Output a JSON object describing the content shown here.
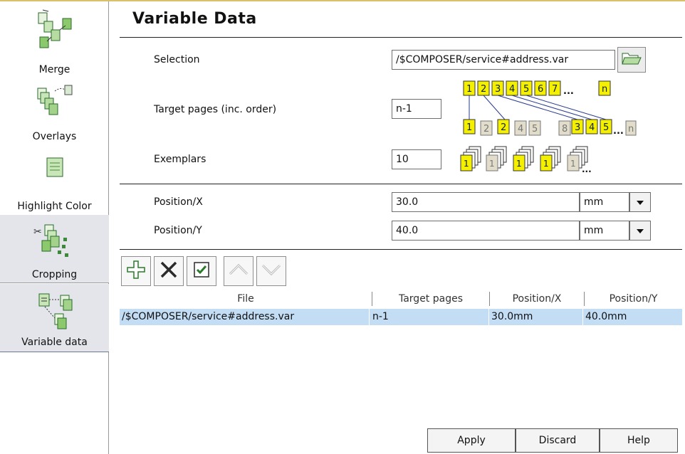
{
  "sidebar": {
    "items": [
      {
        "label": "Merge",
        "icon": "merge-icon"
      },
      {
        "label": "Overlays",
        "icon": "overlays-icon"
      },
      {
        "label": "Highlight Color",
        "icon": "highlight-color-icon"
      },
      {
        "label": "Cropping",
        "icon": "cropping-icon"
      },
      {
        "label": "Variable data",
        "icon": "variable-data-icon"
      }
    ]
  },
  "main": {
    "title": "Variable Data",
    "selection": {
      "label": "Selection",
      "value": "/$COMPOSER/service#address.var",
      "browse_icon": "folder-open-icon"
    },
    "target_pages": {
      "label": "Target pages (inc. order)",
      "value": "n-1",
      "illustration": {
        "source_pages": [
          "1",
          "2",
          "3",
          "4",
          "5",
          "6",
          "7",
          "...",
          "n"
        ],
        "result_pages": [
          "1",
          "2",
          "2",
          "4",
          "5",
          "3",
          "4",
          "8",
          "5",
          "...",
          "n"
        ]
      }
    },
    "exemplars": {
      "label": "Exemplars",
      "value": "10",
      "illustration": {
        "stack_labels": [
          "1",
          "1",
          "1",
          "1",
          "1"
        ],
        "more": "..."
      }
    },
    "position_x": {
      "label": "Position/X",
      "value": "30.0",
      "unit": "mm"
    },
    "position_y": {
      "label": "Position/Y",
      "value": "40.0",
      "unit": "mm"
    }
  },
  "toolbar": {
    "buttons": [
      {
        "icon": "add-icon"
      },
      {
        "icon": "delete-icon"
      },
      {
        "icon": "checkbox-icon"
      },
      {
        "icon": "move-up-icon"
      },
      {
        "icon": "move-down-icon"
      }
    ]
  },
  "table": {
    "columns": [
      "File",
      "Target pages",
      "Position/X",
      "Position/Y"
    ],
    "rows": [
      [
        "/$COMPOSER/service#address.var",
        "n-1",
        "30.0mm",
        "40.0mm"
      ]
    ]
  },
  "buttons": {
    "apply": "Apply",
    "discard": "Discard",
    "help": "Help"
  },
  "colors": {
    "page_yellow": "#f4f000",
    "selected_row": "#c3ddf5",
    "sidebar_selected": "#e3e5ea"
  }
}
